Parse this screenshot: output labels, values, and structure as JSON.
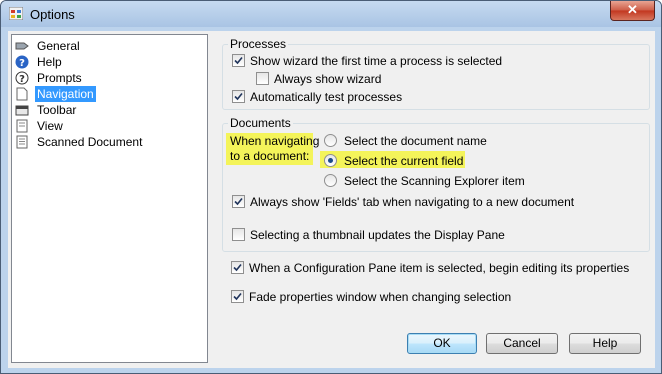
{
  "window": {
    "title": "Options",
    "close_label": "✕"
  },
  "nav": {
    "items": [
      {
        "label": "General",
        "icon": "general-icon"
      },
      {
        "label": "Help",
        "icon": "help-icon"
      },
      {
        "label": "Prompts",
        "icon": "prompts-icon"
      },
      {
        "label": "Navigation",
        "icon": "navigation-icon",
        "selected": true
      },
      {
        "label": "Toolbar",
        "icon": "toolbar-icon"
      },
      {
        "label": "View",
        "icon": "view-icon"
      },
      {
        "label": "Scanned Document",
        "icon": "scanned-document-icon"
      }
    ]
  },
  "processes": {
    "title": "Processes",
    "show_wizard": {
      "label": "Show wizard the first time a process is selected",
      "checked": true
    },
    "always_show_wizard": {
      "label": "Always show wizard",
      "checked": false
    },
    "auto_test": {
      "label": "Automatically test processes",
      "checked": true
    }
  },
  "documents": {
    "title": "Documents",
    "when_navigating_line1": "When navigating",
    "when_navigating_line2": "to a document:",
    "radio_name": {
      "label": "Select the document name",
      "checked": false
    },
    "radio_field": {
      "label": "Select the current field",
      "checked": true
    },
    "radio_explorer": {
      "label": "Select the Scanning Explorer item",
      "checked": false
    },
    "always_show_fields": {
      "label": "Always show 'Fields' tab when navigating to a new document",
      "checked": true
    },
    "thumbnail_updates": {
      "label": "Selecting a thumbnail updates the Display Pane",
      "checked": false
    }
  },
  "config_pane_edit": {
    "label": "When a Configuration Pane item is selected, begin editing its properties",
    "checked": true
  },
  "fade_properties": {
    "label": "Fade properties window when changing selection",
    "checked": true
  },
  "buttons": {
    "ok": "OK",
    "cancel": "Cancel",
    "help": "Help"
  },
  "colors": {
    "highlight": "#f4f45a",
    "selection": "#3399ff"
  }
}
